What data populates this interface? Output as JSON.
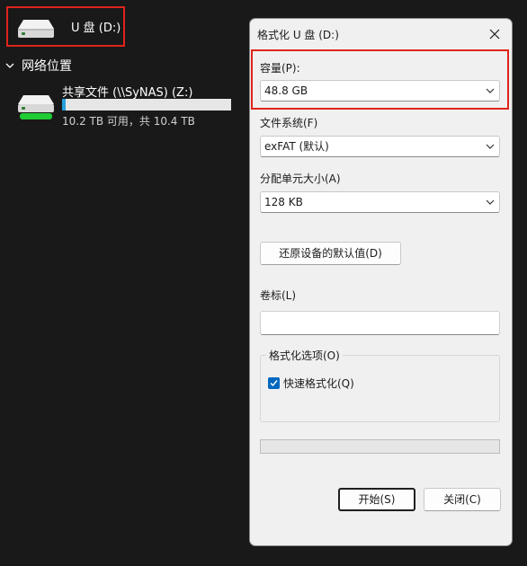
{
  "explorer": {
    "usb_drive": {
      "label": "U 盘 (D:)",
      "icon": "drive-icon"
    },
    "network_section": {
      "label": "网络位置",
      "icon": "chevron-down-icon"
    },
    "network_drive": {
      "name": "共享文件 (\\\\SyNAS) (Z:)",
      "free_text": "10.2 TB 可用，共 10.4 TB",
      "used_fraction": 0.02,
      "icon": "network-drive-icon",
      "bar_color": "#26a0da",
      "status_color": "#1fcc34"
    }
  },
  "dialog": {
    "title": "格式化 U 盘 (D:)",
    "capacity": {
      "label": "容量(P):",
      "value": "48.8 GB"
    },
    "filesystem": {
      "label": "文件系统(F)",
      "value": "exFAT (默认)"
    },
    "allocation": {
      "label": "分配单元大小(A)",
      "value": "128 KB"
    },
    "restore_defaults_label": "还原设备的默认值(D)",
    "volume_label": {
      "label": "卷标(L)",
      "value": ""
    },
    "format_options": {
      "label": "格式化选项(O)",
      "quick_format_label": "快速格式化(Q)",
      "quick_format_checked": true
    },
    "progress_fraction": 0,
    "start_label": "开始(S)",
    "close_label": "关闭(C)",
    "accent_color": "#0067c0",
    "highlight_color": "#e0241b"
  }
}
